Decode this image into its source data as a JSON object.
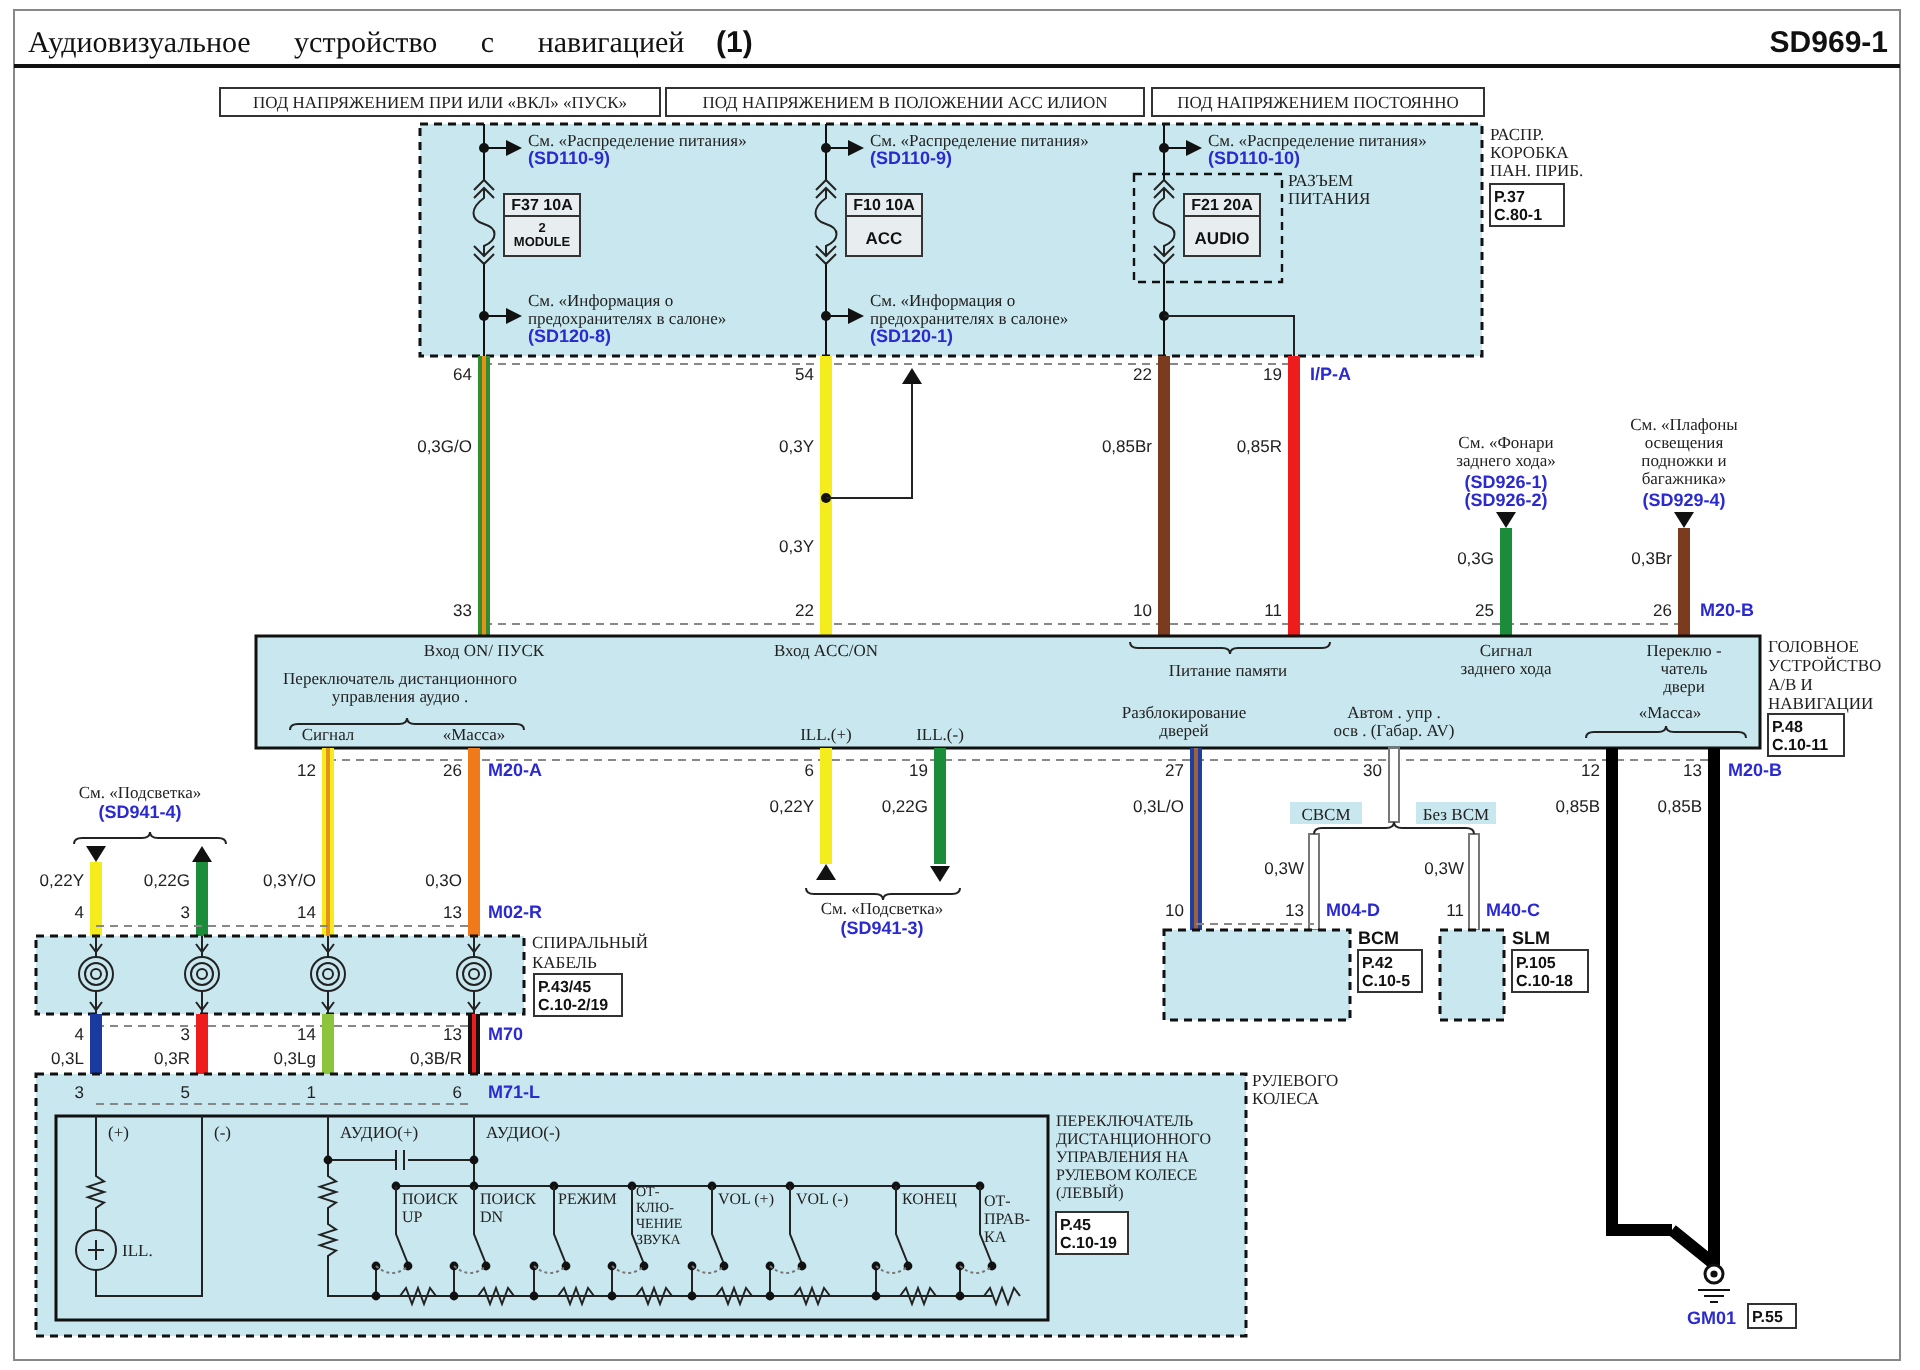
{
  "header": {
    "title": "Аудиовизуальное устройство с навигацией",
    "number": "(1)",
    "code": "SD969-1"
  },
  "power_conditions": [
    "ПОД НАПРЯЖЕНИЕМ ПРИ ИЛИ «ВКЛ» «ПУСК»",
    "ПОД НАПРЯЖЕНИЕМ В ПОЛОЖЕНИИ ACC ИЛИON",
    "ПОД НАПРЯЖЕНИЕМ ПОСТОЯННО"
  ],
  "fuse_box": {
    "name": [
      "РАСПР.",
      "КОРОБКА",
      "ПАН. ПРИБ."
    ],
    "ref": [
      "P.37",
      "C.80-1"
    ],
    "connector": [
      "РАЗЪЕМ",
      "ПИТАНИЯ"
    ],
    "fuses": [
      {
        "feed_ref": "См. «Распределение питания»",
        "feed_code": "(SD110-9)",
        "name": "F37 10A",
        "label": [
          "2",
          "MODULE"
        ],
        "info_ref": [
          "См. «Информация о",
          "предохранителях в салоне»"
        ],
        "info_code": "(SD120-8)"
      },
      {
        "feed_ref": "См. «Распределение питания»",
        "feed_code": "(SD110-9)",
        "name": "F10 10A",
        "label": [
          "ACC"
        ],
        "info_ref": [
          "См. «Информация о",
          "предохранителях в салоне»"
        ],
        "info_code": "(SD120-1)"
      },
      {
        "feed_ref": "См. «Распределение питания»",
        "feed_code": "(SD110-10)",
        "name": "F21 20A",
        "label": [
          "AUDIO"
        ]
      }
    ]
  },
  "supply_wires": [
    {
      "top_pin": "64",
      "gauges": [
        "0,3G/O"
      ],
      "bottom_pin": "33",
      "color": "#2f8f2f",
      "stripe": {
        "color": "#e8901a"
      }
    },
    {
      "top_pin": "54",
      "gauges": [
        "0,3Y",
        "0,3Y"
      ],
      "bottom_pin": "22",
      "color": "#f4ec1c"
    },
    {
      "top_pin": "22",
      "gauges": [
        "0,85Br"
      ],
      "bottom_pin": "10",
      "color": "#7a3b1e"
    },
    {
      "top_pin": "19",
      "connector": "I/P-A",
      "gauges": [
        "0,85R"
      ],
      "bottom_pin": "11",
      "color": "#ee1c1c"
    },
    {
      "reference": [
        "См. «Фонари",
        "заднего хода»"
      ],
      "codes": [
        "(SD926-1)",
        "(SD926-2)"
      ],
      "gauges": [
        "0,3G"
      ],
      "bottom_pin": "25",
      "color": "#1a8c3a"
    },
    {
      "reference": [
        "См. «Плафоны",
        "освещения",
        "подножки и",
        "багажника»"
      ],
      "codes": [
        "(SD929-4)"
      ],
      "gauges": [
        "0,3Br"
      ],
      "bottom_pin": "26",
      "connector": "M20-B",
      "color": "#7a3b1e"
    }
  ],
  "head_unit": {
    "name": [
      "ГОЛОВНОЕ",
      "УСТРОЙСТВО",
      "А/В И",
      "НАВИГАЦИИ"
    ],
    "ref": [
      "P.48",
      "C.10-11"
    ],
    "labels": [
      [
        "Вход ON/ ПУСК"
      ],
      [
        "Вход ACC/ON"
      ],
      [
        "Питание памяти"
      ],
      [
        "Сигнал",
        "заднего хода"
      ],
      [
        "Переклю -",
        "чатель",
        "двери"
      ],
      [
        "Переключатель дистанционного",
        "управления аудио ."
      ],
      [
        "Сигнал"
      ],
      [
        "«Масса»"
      ],
      [
        "ILL.(+)"
      ],
      [
        "ILL.(-)"
      ],
      [
        "Разблокирование",
        "дверей"
      ],
      [
        "Автом . упр .",
        "осв . (Габар. AV)"
      ],
      [
        "«Масса»"
      ]
    ]
  },
  "head_unit_wires": [
    {
      "pin": "12",
      "gauge": "0,3Y/O",
      "color": "#f4ec1c",
      "stripe": {
        "color": "#e8901a"
      }
    },
    {
      "pin": "26",
      "connector": "M20-A",
      "gauge": "0,3O",
      "color": "#f07a1a"
    },
    {
      "pin": "6",
      "gauge": "0,22Y",
      "color": "#f4ec1c",
      "points_up": true
    },
    {
      "pin": "19",
      "gauge": "0,22G",
      "color": "#1a8c3a",
      "points_up": false
    },
    {
      "pin": "27",
      "gauge": "0,3L/O",
      "color": "#2040a0",
      "stripe": {
        "color": "#a06040"
      },
      "end_pin": "10"
    },
    {
      "pin": "30",
      "color": "#ffffff",
      "branches": [
        {
          "label": "CBCM",
          "gauge": "0,3W",
          "pin": "13",
          "connector": "M04-D"
        },
        {
          "label": "Без BCM",
          "gauge": "0,3W",
          "pin": "11",
          "connector": "M40-C"
        }
      ]
    },
    {
      "pin": "12",
      "gauge": "0,85B",
      "color": "#000000"
    },
    {
      "pin": "13",
      "connector": "M20-B",
      "gauge": "0,85B",
      "color": "#000000"
    }
  ],
  "illumination_output": {
    "reference": "См. «Подсветка»",
    "code": "(SD941-3)"
  },
  "modules": [
    {
      "name": "BCM",
      "ref": [
        "P.42",
        "C.10-5"
      ]
    },
    {
      "name": "SLM",
      "ref": [
        "P.105",
        "C.10-18"
      ]
    }
  ],
  "ground": {
    "name": "GM01",
    "ref": "P.55"
  },
  "illumination_input": {
    "reference": "См. «Подсветка»",
    "code": "(SD941-4)",
    "wires": [
      {
        "gauge": "0,22Y",
        "color": "#f4ec1c",
        "points_up": false
      },
      {
        "gauge": "0,22G",
        "color": "#1a8c3a",
        "points_up": true
      }
    ]
  },
  "clock_spring": {
    "name": [
      "СПИРАЛЬНЫЙ",
      "КАБЕЛЬ"
    ],
    "ref": [
      "P.43/45",
      "C.10-2/19"
    ],
    "input_connector": "M02-R",
    "output_connector": "M70",
    "channels": [
      {
        "in_pin": "4",
        "out_pin": "4",
        "gauge": "0,3L",
        "color": "#1a3aa0"
      },
      {
        "in_pin": "3",
        "out_pin": "3",
        "gauge": "0,3R",
        "color": "#ee1c1c"
      },
      {
        "in_pin": "14",
        "out_pin": "14",
        "gauge": "0,3Lg",
        "color": "#8cc43c"
      },
      {
        "in_pin": "13",
        "out_pin": "13",
        "gauge": "0,3B/R",
        "color": "#111111",
        "stripe": {
          "color": "#ee1c1c"
        }
      }
    ]
  },
  "steering_switch": {
    "location": [
      "РУЛЕВОГО",
      "КОЛЕСА"
    ],
    "name": [
      "ПЕРЕКЛЮЧАТЕЛЬ",
      "ДИСТАНЦИОННОГО",
      "УПРАВЛЕНИЯ НА",
      "РУЛЕВОМ КОЛЕСЕ",
      "(ЛЕВЫЙ)"
    ],
    "ref": [
      "P.45",
      "C.10-19"
    ],
    "connector": "M71-L",
    "pins": [
      {
        "pin": "3",
        "label": "(+)"
      },
      {
        "pin": "5",
        "label": "(-)"
      },
      {
        "pin": "1",
        "label": "АУДИО(+)"
      },
      {
        "pin": "6",
        "label": "АУДИО(-)"
      }
    ],
    "lamp": "ILL.",
    "buttons": [
      [
        "ПОИСК",
        "UP"
      ],
      [
        "ПОИСК",
        "DN"
      ],
      [
        "РЕЖИМ"
      ],
      [
        "ОТ-",
        "КЛЮ-",
        "ЧЕНИЕ",
        "ЗВУКА"
      ],
      [
        "VOL (+)"
      ],
      [
        "VOL (-)"
      ],
      [
        "КОНЕЦ"
      ],
      [
        "ОТ-",
        "ПРАВ-",
        "КА"
      ]
    ]
  }
}
